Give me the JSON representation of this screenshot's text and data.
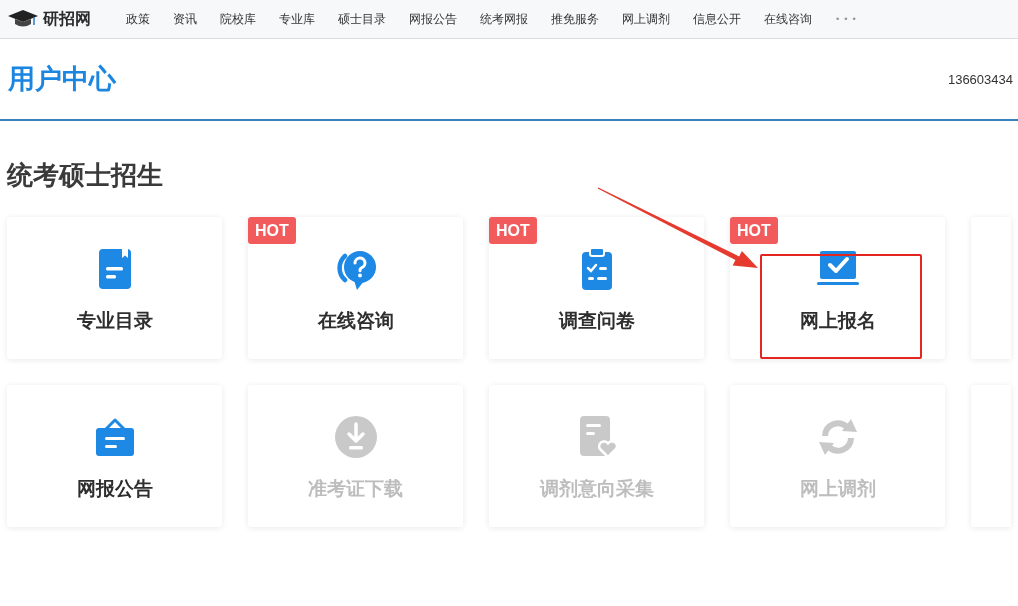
{
  "nav": {
    "logo": "研招网",
    "items": [
      {
        "label": "政策"
      },
      {
        "label": "资讯"
      },
      {
        "label": "院校库"
      },
      {
        "label": "专业库"
      },
      {
        "label": "硕士目录"
      },
      {
        "label": "网报公告"
      },
      {
        "label": "统考网报"
      },
      {
        "label": "推免服务"
      },
      {
        "label": "网上调剂"
      },
      {
        "label": "信息公开"
      },
      {
        "label": "在线咨询"
      }
    ],
    "more": "•••"
  },
  "header": {
    "title": "用户中心",
    "user": "136603434"
  },
  "sections": [
    {
      "title": "统考硕士招生",
      "rows": [
        {
          "cards": [
            {
              "kind": "catalog",
              "label": "专业目录",
              "disabled": false,
              "highlighted": false
            },
            {
              "kind": "consult",
              "label": "在线咨询",
              "badge": "HOT",
              "disabled": false,
              "highlighted": false
            },
            {
              "kind": "survey",
              "label": "调查问卷",
              "badge": "HOT",
              "disabled": false,
              "highlighted": false
            },
            {
              "kind": "apply",
              "label": "网上报名",
              "badge": "HOT",
              "disabled": false,
              "highlighted": true
            }
          ]
        },
        {
          "cards": [
            {
              "kind": "announcement",
              "label": "网报公告",
              "disabled": false,
              "highlighted": false
            },
            {
              "kind": "download",
              "label": "准考证下载",
              "disabled": true,
              "highlighted": false
            },
            {
              "kind": "intention",
              "label": "调剂意向采集",
              "disabled": true,
              "highlighted": false
            },
            {
              "kind": "transfer",
              "label": "网上调剂",
              "disabled": true,
              "highlighted": false
            }
          ]
        }
      ]
    }
  ]
}
